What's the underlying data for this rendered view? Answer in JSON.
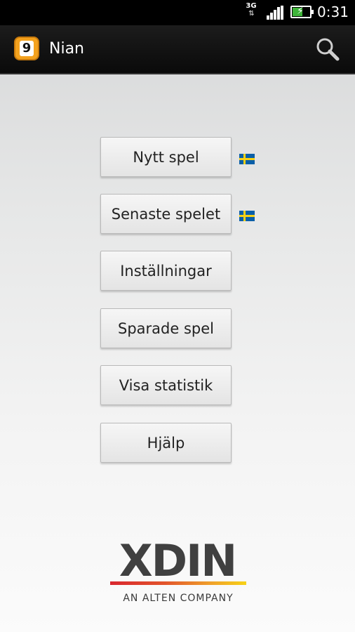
{
  "status_bar": {
    "network": "3G",
    "network_activity": "⇅",
    "time": "0:31",
    "battery_level_percent": 60
  },
  "action_bar": {
    "app_icon_digit": "9",
    "title": "Nian",
    "search_icon": "search-icon"
  },
  "menu": {
    "items": [
      {
        "label": "Nytt spel",
        "flag": "sweden-flag"
      },
      {
        "label": "Senaste spelet",
        "flag": "sweden-flag"
      },
      {
        "label": "Inställningar"
      },
      {
        "label": "Sparade spel"
      },
      {
        "label": "Visa statistik"
      },
      {
        "label": "Hjälp"
      }
    ]
  },
  "logo": {
    "wordmark": "XDIN",
    "tagline": "AN ALTEN COMPANY",
    "colors": {
      "text": "#404040",
      "stripe_start": "#d9262e",
      "stripe_end": "#f7d116"
    }
  },
  "colors": {
    "accent": "#f4a21e",
    "flag_blue": "#0a5fa8",
    "flag_yellow": "#f7d116"
  }
}
